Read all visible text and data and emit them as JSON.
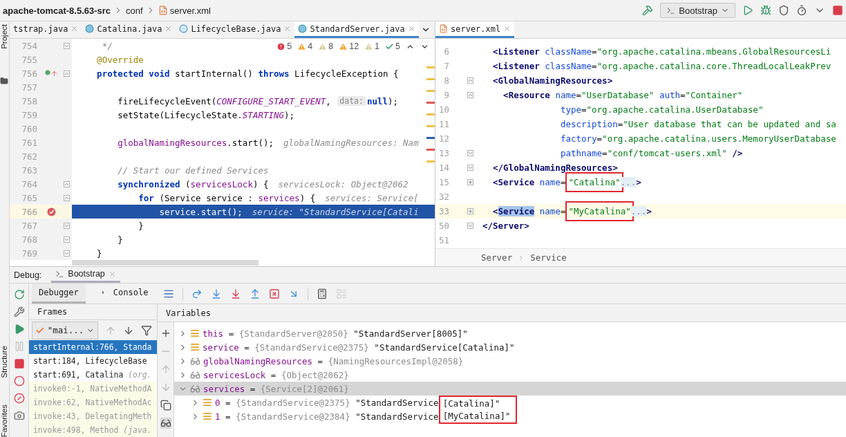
{
  "breadcrumb": [
    {
      "label": "apache-tomcat-8.5.63-src",
      "kind": "project"
    },
    {
      "label": "conf",
      "kind": "folder"
    },
    {
      "label": "server.xml",
      "kind": "xml"
    }
  ],
  "run_toolbar": {
    "config": "Bootstrap",
    "actions": [
      {
        "kind": "run"
      },
      {
        "kind": "debug"
      },
      {
        "kind": "coverage"
      },
      {
        "kind": "profile"
      },
      {
        "kind": "more"
      },
      {
        "kind": "stop"
      }
    ]
  },
  "side_stripe": [
    {
      "label": "Project",
      "kind": "top"
    },
    {
      "label": "Structure",
      "kind": "bottom"
    },
    {
      "label": "Favorites",
      "kind": "bottom"
    }
  ],
  "java_editor": {
    "tabs": [
      {
        "label": "tstrap.java",
        "kind": "plain",
        "selected": false
      },
      {
        "label": "Catalina.java",
        "kind": "class",
        "selected": false
      },
      {
        "label": "LifecycleBase.java",
        "kind": "abstract",
        "selected": false
      },
      {
        "label": "StandardServer.java",
        "kind": "class",
        "selected": true
      }
    ],
    "inspections": [
      {
        "kind": "error",
        "count": "5"
      },
      {
        "kind": "warning",
        "count": "4"
      },
      {
        "kind": "weak",
        "count": "8"
      },
      {
        "kind": "warning",
        "count": "12"
      },
      {
        "kind": "weak",
        "count": "1"
      },
      {
        "kind": "typo",
        "count": "5"
      }
    ],
    "lines": [
      {
        "number": "754",
        "fold": {
          "kind": "close"
        },
        "current": false,
        "tokens": [
          {
            "kind": "comment",
            "text": "     */"
          }
        ]
      },
      {
        "number": "755",
        "current": false,
        "tokens": [
          {
            "kind": "annotation",
            "text": "    @Override"
          }
        ]
      },
      {
        "number": "756",
        "marker": {
          "kind": "override"
        },
        "fold": {
          "kind": "open"
        },
        "current": false,
        "tokens": [
          {
            "kind": "kw",
            "text": "    protected void"
          },
          {
            "kind": "plain",
            "text": " startInternal() "
          },
          {
            "kind": "kw",
            "text": "throws"
          },
          {
            "kind": "plain",
            "text": " LifecycleException {"
          }
        ]
      },
      {
        "number": "757",
        "current": false
      },
      {
        "number": "758",
        "current": false,
        "tokens": [
          {
            "kind": "plain",
            "text": "        fireLifecycleEvent("
          },
          {
            "kind": "const",
            "text": "CONFIGURE_START_EVENT"
          },
          {
            "kind": "plain",
            "text": ", "
          },
          {
            "kind": "param",
            "text": "data:"
          },
          {
            "kind": "kw",
            "text": "null"
          },
          {
            "kind": "plain",
            "text": ");"
          }
        ]
      },
      {
        "number": "759",
        "current": false,
        "tokens": [
          {
            "kind": "plain",
            "text": "        setState(LifecycleState."
          },
          {
            "kind": "const",
            "text": "STARTING"
          },
          {
            "kind": "plain",
            "text": ");"
          }
        ]
      },
      {
        "number": "760",
        "current": false
      },
      {
        "number": "761",
        "current": false,
        "tokens": [
          {
            "kind": "field",
            "text": "        globalNamingResources"
          },
          {
            "kind": "plain",
            "text": ".start();"
          },
          {
            "kind": "hint",
            "text": "globalNamingResources: Nam"
          }
        ]
      },
      {
        "number": "762",
        "current": false
      },
      {
        "number": "763",
        "current": false,
        "tokens": [
          {
            "kind": "comment",
            "text": "        // Start our defined Services"
          }
        ]
      },
      {
        "number": "764",
        "fold": {
          "kind": "open"
        },
        "current": false,
        "tokens": [
          {
            "kind": "kw",
            "text": "        synchronized"
          },
          {
            "kind": "plain",
            "text": " ("
          },
          {
            "kind": "field",
            "text": "servicesLock"
          },
          {
            "kind": "plain",
            "text": ") {"
          },
          {
            "kind": "hint",
            "text": "servicesLock: Object@2062"
          }
        ]
      },
      {
        "number": "765",
        "fold": {
          "kind": "open"
        },
        "current": false,
        "tokens": [
          {
            "kind": "kw",
            "text": "            for"
          },
          {
            "kind": "plain",
            "text": " (Service service : "
          },
          {
            "kind": "field",
            "text": "services"
          },
          {
            "kind": "plain",
            "text": ") {"
          },
          {
            "kind": "hint",
            "text": "services: Service["
          }
        ]
      },
      {
        "number": "766",
        "marker": {
          "kind": "breakpoint"
        },
        "current": true,
        "tokens": [
          {
            "kind": "plain",
            "text": "                service.start();"
          },
          {
            "kind": "hint",
            "text": "service: \"StandardService[Catali"
          }
        ]
      },
      {
        "number": "767",
        "fold": {
          "kind": "close"
        },
        "current": false,
        "tokens": [
          {
            "kind": "plain",
            "text": "            }"
          }
        ]
      },
      {
        "number": "768",
        "fold": {
          "kind": "close"
        },
        "current": false,
        "tokens": [
          {
            "kind": "plain",
            "text": "        }"
          }
        ]
      },
      {
        "number": "769",
        "fold": {
          "kind": "close"
        },
        "current": false,
        "tokens": [
          {
            "kind": "plain",
            "text": "    }"
          }
        ]
      }
    ]
  },
  "xml_editor": {
    "tabs": [
      {
        "label": "server.xml",
        "kind": "xml",
        "selected": true
      }
    ],
    "lines": [
      {
        "number": "6",
        "current": false,
        "tokens": [
          {
            "kind": "tag",
            "text": "  <Listener"
          },
          {
            "kind": "attr",
            "text": " className"
          },
          {
            "kind": "plain",
            "text": "="
          },
          {
            "kind": "value",
            "text": "\"org.apache.catalina.mbeans.GlobalResourcesLi"
          }
        ]
      },
      {
        "number": "7",
        "current": false,
        "tokens": [
          {
            "kind": "tag",
            "text": "  <Listener"
          },
          {
            "kind": "attr",
            "text": " className"
          },
          {
            "kind": "plain",
            "text": "="
          },
          {
            "kind": "value",
            "text": "\"org.apache.catalina.core.ThreadLocalLeakPrev"
          }
        ]
      },
      {
        "number": "8",
        "fold": {
          "kind": "open"
        },
        "current": false,
        "tokens": [
          {
            "kind": "tag",
            "text": "  <GlobalNamingResources>"
          }
        ]
      },
      {
        "number": "9",
        "fold": {
          "kind": "open"
        },
        "current": false,
        "tokens": [
          {
            "kind": "tag",
            "text": "    <Resource"
          },
          {
            "kind": "attr",
            "text": " name"
          },
          {
            "kind": "plain",
            "text": "="
          },
          {
            "kind": "value",
            "text": "\"UserDatabase\""
          },
          {
            "kind": "attr",
            "text": " auth"
          },
          {
            "kind": "plain",
            "text": "="
          },
          {
            "kind": "value",
            "text": "\"Container\""
          }
        ]
      },
      {
        "number": "10",
        "current": false,
        "tokens": [
          {
            "kind": "attr",
            "text": "               type"
          },
          {
            "kind": "plain",
            "text": "="
          },
          {
            "kind": "value",
            "text": "\"org.apache.catalina.UserDatabase\""
          }
        ]
      },
      {
        "number": "11",
        "current": false,
        "tokens": [
          {
            "kind": "attr",
            "text": "               description"
          },
          {
            "kind": "plain",
            "text": "="
          },
          {
            "kind": "value",
            "text": "\"User database that can be updated and sa"
          }
        ]
      },
      {
        "number": "12",
        "current": false,
        "tokens": [
          {
            "kind": "attr",
            "text": "               factory"
          },
          {
            "kind": "plain",
            "text": "="
          },
          {
            "kind": "value",
            "text": "\"org.apache.catalina.users.MemoryUserDatabase"
          }
        ]
      },
      {
        "number": "13",
        "fold": {
          "kind": "close"
        },
        "current": false,
        "tokens": [
          {
            "kind": "attr",
            "text": "               pathname"
          },
          {
            "kind": "plain",
            "text": "="
          },
          {
            "kind": "value",
            "text": "\"conf/tomcat-users.xml\""
          },
          {
            "kind": "tag",
            "text": " />"
          }
        ]
      },
      {
        "number": "14",
        "fold": {
          "kind": "close"
        },
        "current": false,
        "tokens": [
          {
            "kind": "tag",
            "text": "  </GlobalNamingResources>"
          }
        ]
      },
      {
        "number": "15",
        "fold": {
          "kind": "collapsed"
        },
        "current": false,
        "tokens": [
          {
            "kind": "tag",
            "text": "  <Service"
          },
          {
            "kind": "attr",
            "text": " name"
          },
          {
            "kind": "plain",
            "text": "="
          },
          {
            "kind": "value",
            "text": "\"Catalina\"",
            "annotated": true
          },
          {
            "kind": "fold",
            "text": "..."
          },
          {
            "kind": "tag",
            "text": ">"
          }
        ]
      },
      {
        "number": "32",
        "current": false
      },
      {
        "number": "33",
        "fold": {
          "kind": "collapsed"
        },
        "current": true,
        "tokens": [
          {
            "kind": "tag",
            "text": "  <"
          },
          {
            "kind": "selection",
            "text": "Service"
          },
          {
            "kind": "attr",
            "text": " name"
          },
          {
            "kind": "plain",
            "text": "="
          },
          {
            "kind": "value",
            "text": "\"MyCatalina\"",
            "annotated": true
          },
          {
            "kind": "fold",
            "text": "..."
          },
          {
            "kind": "tag",
            "text": ">"
          }
        ]
      },
      {
        "number": "50",
        "fold": {
          "kind": "close"
        },
        "current": false,
        "tokens": [
          {
            "kind": "tag",
            "text": "</Server>"
          }
        ]
      },
      {
        "number": "51",
        "current": false
      }
    ],
    "breadcrumb": [
      "Server",
      "Service"
    ]
  },
  "debug": {
    "title": "Debug:",
    "sessions": [
      {
        "label": "Bootstrap",
        "selected": true
      }
    ],
    "side_actions": [
      {
        "kind": "rerun",
        "disabled": false
      },
      {
        "kind": "settings",
        "disabled": false
      },
      {
        "kind": "resume",
        "disabled": false
      },
      {
        "kind": "pause",
        "disabled": true
      },
      {
        "kind": "stop",
        "disabled": false
      },
      {
        "kind": "breakpoints",
        "disabled": false
      },
      {
        "kind": "mute",
        "disabled": false
      },
      {
        "kind": "camera",
        "disabled": false
      }
    ],
    "tabs": [
      {
        "label": "Debugger",
        "kind": "debugger",
        "selected": true
      },
      {
        "label": "Console",
        "kind": "console",
        "selected": false
      }
    ],
    "step_actions": [
      {
        "kind": "layout",
        "disabled": false
      },
      {
        "kind": "step-over",
        "disabled": false
      },
      {
        "kind": "step-into",
        "disabled": false
      },
      {
        "kind": "force-step-into",
        "disabled": false
      },
      {
        "kind": "step-out",
        "disabled": false
      },
      {
        "kind": "drop-frame",
        "disabled": false
      },
      {
        "kind": "run-to-cursor",
        "disabled": false
      },
      {
        "kind": "evaluate",
        "disabled": false
      },
      {
        "kind": "trace",
        "disabled": true
      }
    ],
    "frames": {
      "title": "Frames",
      "thread": "\"mai...",
      "nav": [
        {
          "kind": "up",
          "disabled": true
        },
        {
          "kind": "down",
          "disabled": false
        },
        {
          "kind": "filter",
          "disabled": false
        }
      ],
      "items": [
        {
          "method": "startInternal:766, Standa",
          "kind": "app",
          "selected": true
        },
        {
          "method": "start:184, LifecycleBase",
          "kind": "app",
          "selected": false
        },
        {
          "method": "start:691, Catalina",
          "package": "(org.",
          "kind": "app",
          "selected": false
        },
        {
          "method": "invoke0:-1, NativeMethodA",
          "kind": "library",
          "selected": false
        },
        {
          "method": "invoke:62, NativeMethodAc",
          "kind": "library",
          "selected": false
        },
        {
          "method": "invoke:43, DelegatingMeth",
          "kind": "library",
          "selected": false
        },
        {
          "method": "invoke:498, Method",
          "package": "(java.",
          "kind": "library",
          "selected": false
        }
      ]
    },
    "variables": {
      "title": "Variables",
      "side_actions": [
        {
          "kind": "add",
          "disabled": false
        },
        {
          "kind": "remove",
          "disabled": true
        },
        {
          "kind": "up",
          "disabled": true
        },
        {
          "kind": "down",
          "disabled": true
        },
        {
          "kind": "copy",
          "disabled": false
        },
        {
          "kind": "watches",
          "disabled": false,
          "on": true
        }
      ],
      "items": [
        {
          "name": "this",
          "sep": "=",
          "kind": "field",
          "type": "{StandardServer@2050}",
          "value": "\"StandardServer[8005]\"",
          "expanded": false,
          "selected": false
        },
        {
          "name": "service",
          "sep": "=",
          "kind": "field",
          "type": "{StandardService@2375}",
          "value": "\"StandardService[Catalina]\"",
          "expanded": false,
          "selected": false
        },
        {
          "name": "globalNamingResources",
          "sep": "=",
          "kind": "watch",
          "type": "{NamingResourcesImpl@2058}",
          "expanded": false,
          "selected": false
        },
        {
          "name": "servicesLock",
          "sep": "=",
          "kind": "watch",
          "type": "{Object@2062}",
          "expanded": false,
          "selected": false
        },
        {
          "name": "services",
          "sep": "=",
          "kind": "watch",
          "type": "{Service[2]@2061}",
          "expanded": true,
          "selected": true,
          "children": [
            {
              "name": "0",
              "sep": "=",
              "kind": "field",
              "type": "{StandardService@2375}",
              "value": "\"StandardService",
              "value_marked": "[Catalina]\"",
              "expanded": false,
              "selected": false
            },
            {
              "name": "1",
              "sep": "=",
              "kind": "field",
              "type": "{StandardService@2384}",
              "value": "\"StandardService",
              "value_marked": "[MyCatalina]\"",
              "expanded": false,
              "selected": false
            }
          ]
        }
      ]
    }
  }
}
